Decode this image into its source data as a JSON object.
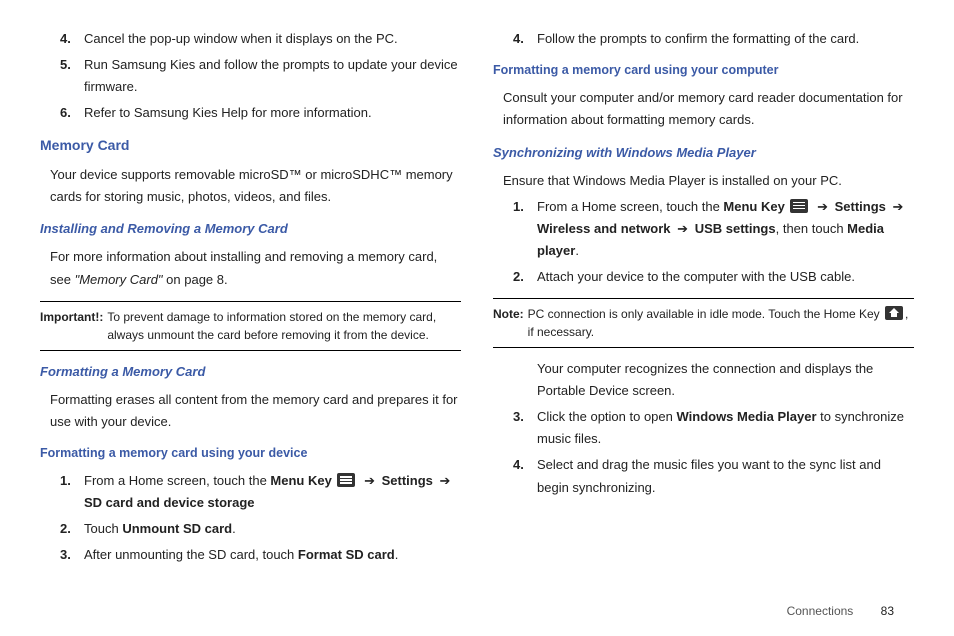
{
  "left": {
    "steps_top": [
      {
        "n": "4.",
        "text": "Cancel the pop-up window when it displays on the PC."
      },
      {
        "n": "5.",
        "text": "Run Samsung Kies and follow the prompts to update your device firmware."
      },
      {
        "n": "6.",
        "text": "Refer to Samsung Kies Help for more information."
      }
    ],
    "memory_card_heading": "Memory Card",
    "memory_card_intro": "Your device supports removable microSD™ or microSDHC™ memory cards for storing music, photos, videos, and files.",
    "install_heading": "Installing and Removing a Memory Card",
    "install_text_prefix": "For more information about installing and removing a memory card, see ",
    "install_text_ref": "\"Memory Card\"",
    "install_text_suffix": " on page 8.",
    "important_label": "Important!:",
    "important_text": "To prevent damage to information stored on the memory card, always unmount the card before removing it from the device.",
    "format_heading": "Formatting a Memory Card",
    "format_intro": "Formatting erases all content from the memory card and prepares it for use with your device.",
    "format_device_heading": "Formatting a memory card using your device",
    "format_device_step1_prefix": "From a Home screen, touch the ",
    "format_device_step1_menu": "Menu Key",
    "format_device_step1_settings": "Settings",
    "format_device_step1_sd": "SD card and device storage",
    "format_device_step2_prefix": "Touch ",
    "format_device_step2_bold": "Unmount SD card",
    "format_device_step2_suffix": ".",
    "format_device_step3_prefix": "After unmounting the SD card, touch ",
    "format_device_step3_bold": "Format SD card",
    "format_device_step3_suffix": "."
  },
  "right": {
    "step4": "Follow the prompts to confirm the formatting of the card.",
    "format_computer_heading": "Formatting a memory card using your computer",
    "format_computer_text": "Consult your computer and/or memory card reader documentation for information about formatting memory cards.",
    "sync_heading": "Synchronizing with Windows Media Player",
    "sync_intro": "Ensure that Windows Media Player is installed on your PC.",
    "sync_step1_prefix": "From a Home screen, touch the ",
    "sync_step1_menu": "Menu Key",
    "sync_step1_settings": "Settings",
    "sync_step1_wireless": "Wireless and network",
    "sync_step1_usb": "USB settings",
    "sync_step1_then": ", then touch ",
    "sync_step1_media": "Media player",
    "sync_step1_end": ".",
    "sync_step2": "Attach your device to the computer with the USB cable.",
    "note_label": "Note:",
    "note_text": "PC connection is only available in idle mode. Touch the Home Key ",
    "note_suffix": ", if necessary.",
    "sync_result": "Your computer recognizes the connection and displays the Portable Device screen.",
    "sync_step3_prefix": "Click the option to open ",
    "sync_step3_bold": "Windows Media Player",
    "sync_step3_suffix": " to synchronize music files.",
    "sync_step4": "Select and drag the music files you want to the sync list and begin synchronizing."
  },
  "footer": {
    "section": "Connections",
    "page": "83"
  },
  "arrow": "➔"
}
